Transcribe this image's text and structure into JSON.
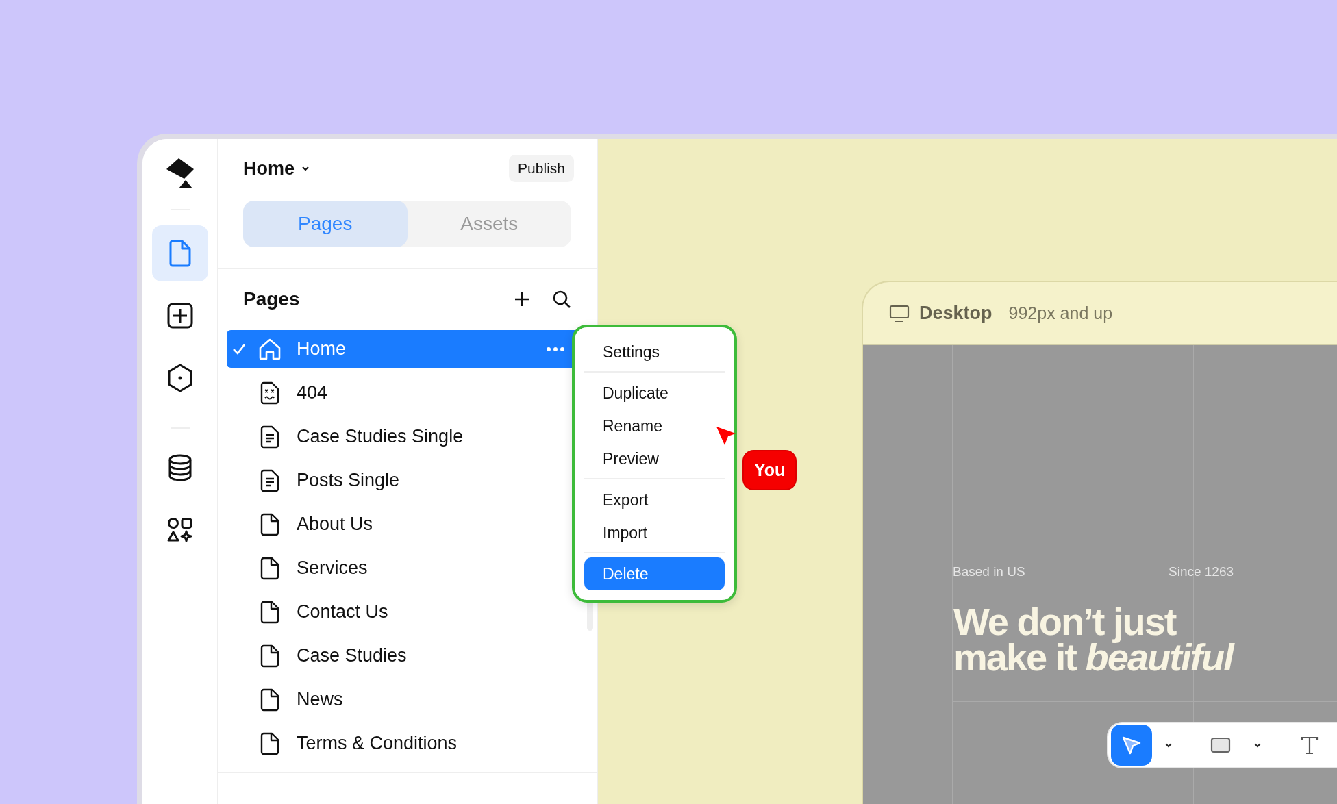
{
  "rail": [
    {
      "kind": "pages",
      "selected": true
    },
    {
      "kind": "add",
      "selected": false
    },
    {
      "kind": "component",
      "selected": false
    },
    {
      "kind": "database",
      "selected": false
    },
    {
      "kind": "assets",
      "selected": false
    }
  ],
  "header": {
    "title": "Home",
    "publish": "Publish"
  },
  "tabs": [
    {
      "label": "Pages",
      "selected": true
    },
    {
      "label": "Assets",
      "selected": false
    }
  ],
  "pages_section": {
    "heading": "Pages"
  },
  "pages": [
    {
      "label": "Home",
      "kind": "home",
      "selected": true
    },
    {
      "label": "404",
      "kind": "error",
      "selected": false
    },
    {
      "label": "Case Studies Single",
      "kind": "template",
      "selected": false
    },
    {
      "label": "Posts Single",
      "kind": "template",
      "selected": false
    },
    {
      "label": "About Us",
      "kind": "page",
      "selected": false
    },
    {
      "label": "Services",
      "kind": "page",
      "selected": false
    },
    {
      "label": "Contact Us",
      "kind": "page",
      "selected": false
    },
    {
      "label": "Case Studies",
      "kind": "page",
      "selected": false
    },
    {
      "label": "News",
      "kind": "page",
      "selected": false
    },
    {
      "label": "Terms & Conditions",
      "kind": "page",
      "selected": false
    }
  ],
  "context_menu": {
    "groups": [
      [
        {
          "label": "Settings",
          "selected": false
        }
      ],
      [
        {
          "label": "Duplicate",
          "selected": false
        },
        {
          "label": "Rename",
          "selected": false
        },
        {
          "label": "Preview",
          "selected": false
        }
      ],
      [
        {
          "label": "Export",
          "selected": false
        },
        {
          "label": "Import",
          "selected": false
        }
      ],
      [
        {
          "label": "Delete",
          "selected": true
        }
      ]
    ]
  },
  "cursor": {
    "label": "You"
  },
  "device": {
    "name": "Desktop",
    "range": "992px and up"
  },
  "preview": {
    "tagline_left": "Based in US",
    "tagline_right": "Since 1263",
    "headline": "We don’t just\nmake it *beautiful*"
  },
  "toolbar": [
    {
      "kind": "select",
      "selected": true,
      "dropdown": true
    },
    {
      "kind": "rectangle",
      "selected": false,
      "dropdown": true
    },
    {
      "kind": "text",
      "selected": false
    }
  ]
}
